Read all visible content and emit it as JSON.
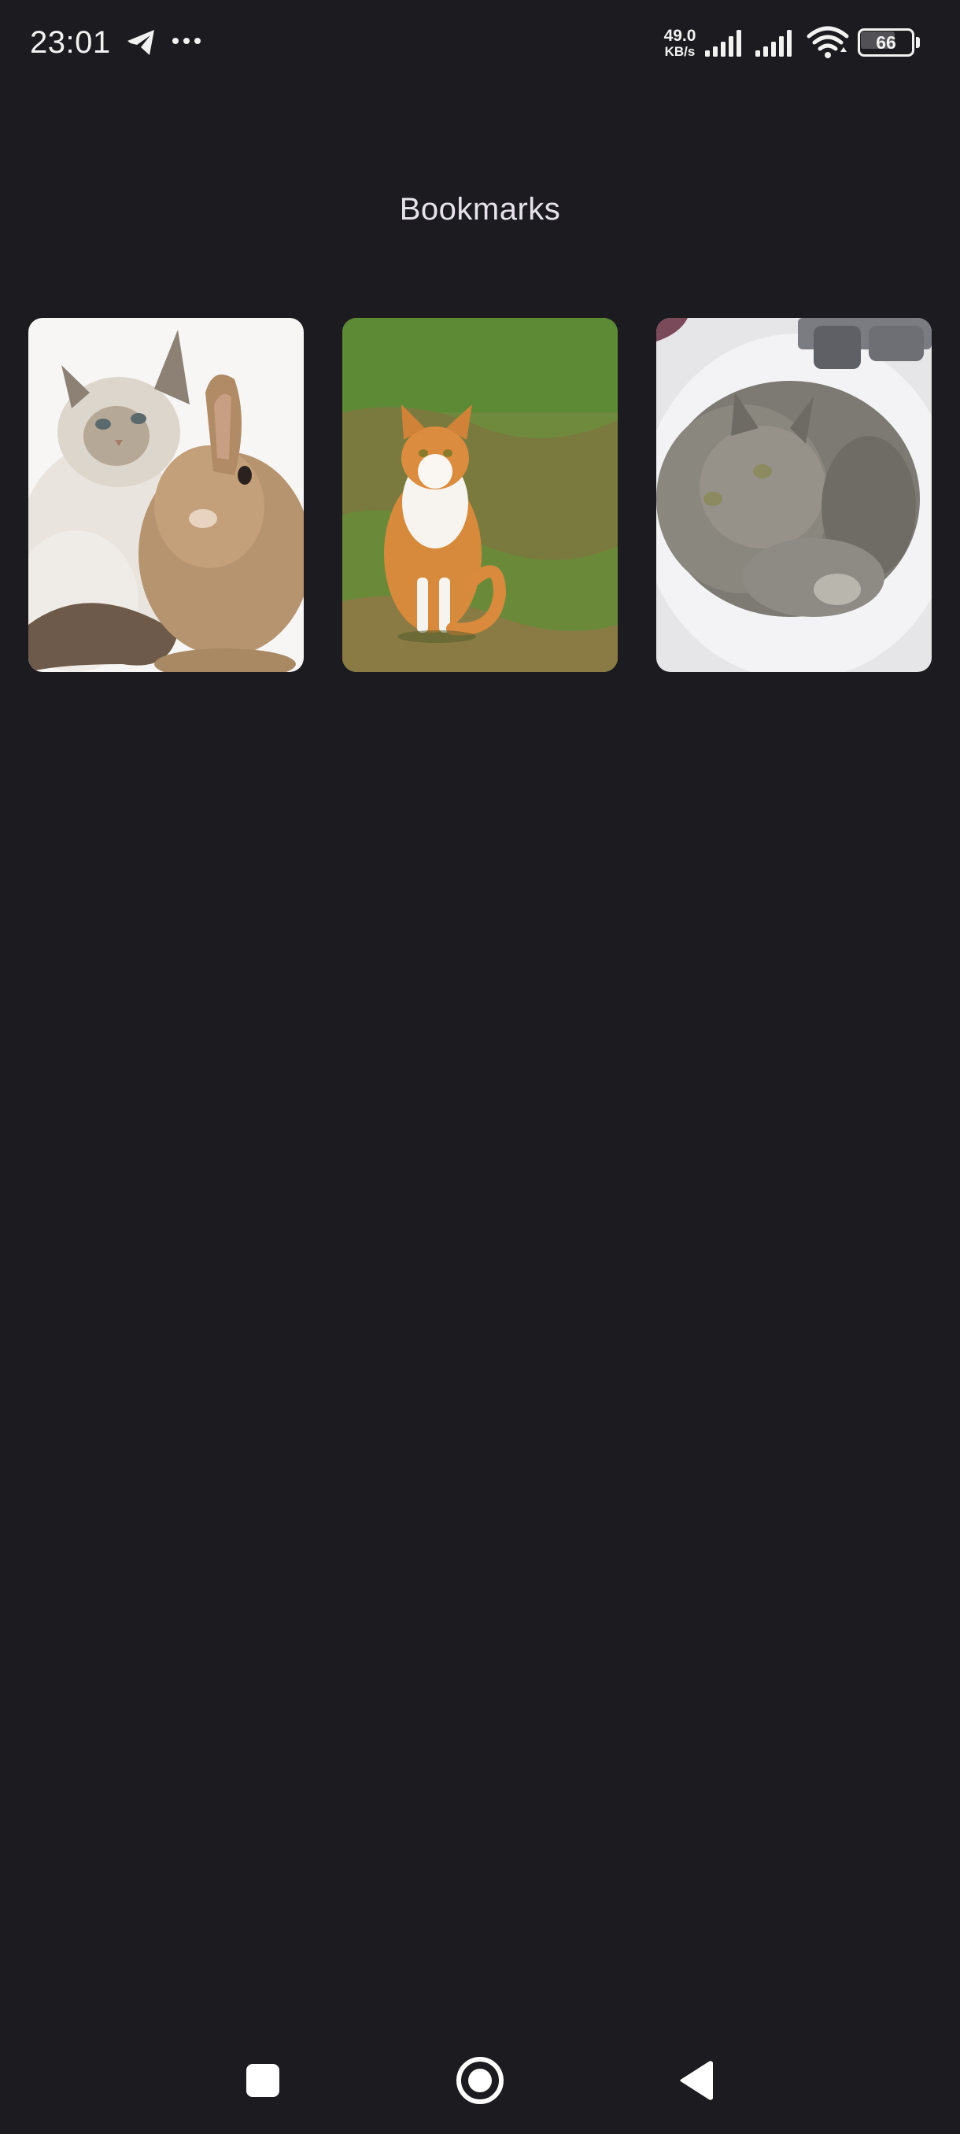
{
  "status_bar": {
    "time": "23:01",
    "net_speed_value": "49.0",
    "net_speed_unit": "KB/s",
    "battery_level": "66",
    "icons": [
      "telegram-icon",
      "more-dots-icon",
      "signal-icon",
      "signal-icon",
      "wifi-icon",
      "battery-icon"
    ]
  },
  "page": {
    "title": "Bookmarks"
  },
  "bookmarks": [
    {
      "image": "kitten-and-rabbit-photo"
    },
    {
      "image": "orange-white-cat-on-grass-photo"
    },
    {
      "image": "gray-cat-in-sink-photo"
    }
  ],
  "nav_bar": {
    "icons": [
      "recents-square-icon",
      "home-circle-icon",
      "back-triangle-icon"
    ]
  },
  "colors": {
    "background": "#1c1b20",
    "text": "#e6e4ea"
  }
}
